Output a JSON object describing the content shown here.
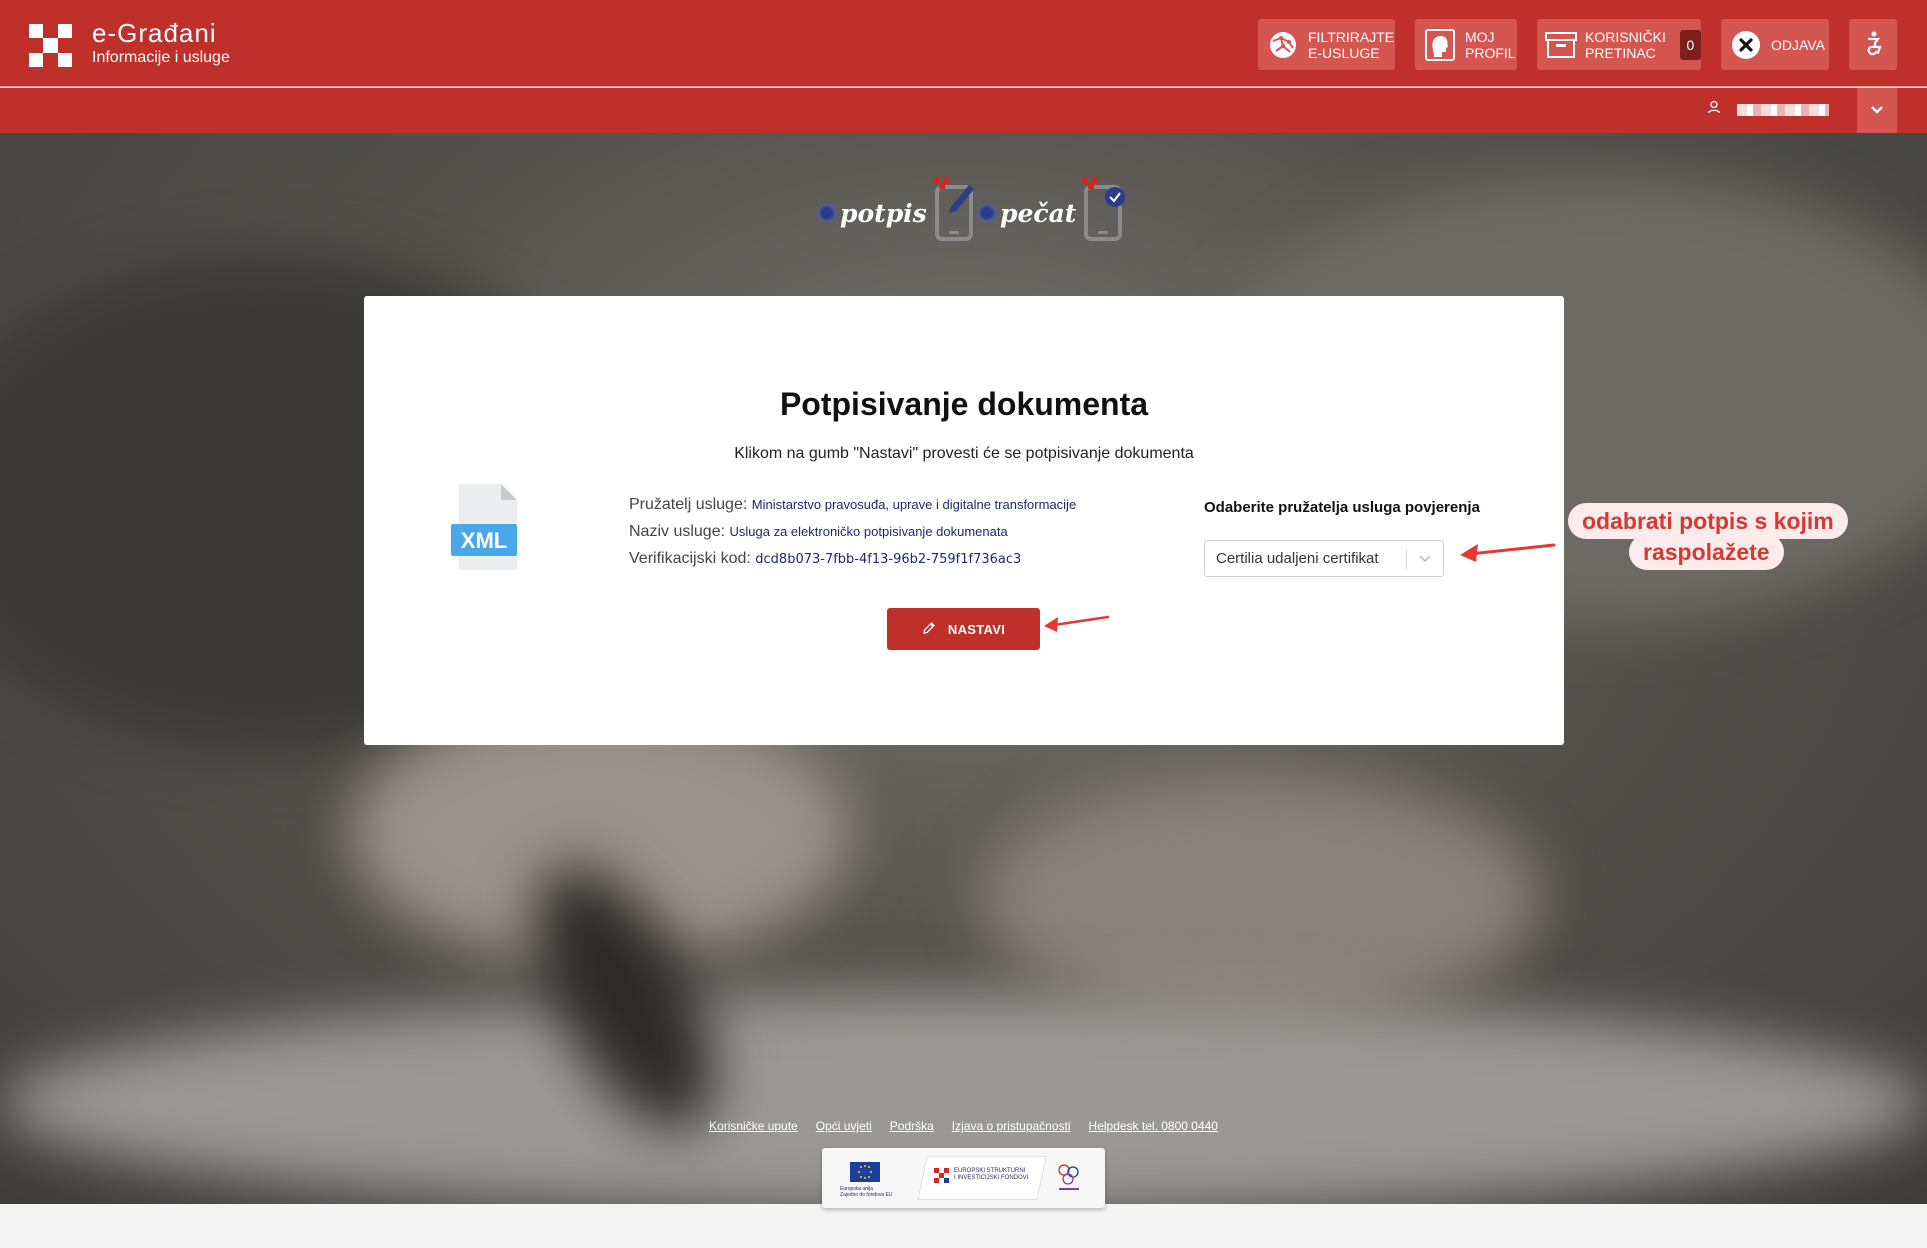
{
  "header": {
    "brand_title": "e-Građani",
    "brand_subtitle": "Informacije i usluge",
    "buttons": [
      {
        "id": "filter",
        "label": "FILTRIRAJTE\nE-USLUGE",
        "icon": "globe-network-icon"
      },
      {
        "id": "profile",
        "label": "MOJ\nPROFIL",
        "icon": "profile-head-icon"
      },
      {
        "id": "inbox",
        "label": "KORISNIČKI\nPRETINAC",
        "icon": "inbox-box-icon",
        "count": "0"
      },
      {
        "id": "logout",
        "label": "ODJAVA",
        "icon": "close-icon"
      },
      {
        "id": "accessibility",
        "label": "",
        "icon": "accessibility-icon"
      }
    ]
  },
  "service_logos": [
    {
      "word": "potpis",
      "icon": "phone-pen-icon"
    },
    {
      "word": "pečat",
      "icon": "phone-check-icon"
    }
  ],
  "card": {
    "title": "Potpisivanje dokumenta",
    "lead": "Klikom na gumb \"Nastavi\" provesti će se potpisivanje dokumenta",
    "file_type": "XML",
    "info": [
      {
        "label": "Pružatelj usluge:",
        "value": "Ministarstvo pravosuđa, uprave i digitalne transformacije"
      },
      {
        "label": "Naziv usluge:",
        "value": "Usluga za elektroničko potpisivanje dokumenata"
      },
      {
        "label": "Verifikacijski kod:",
        "value": "dcd8b073-7fbb-4f13-96b2-759f1f736ac3"
      }
    ],
    "select_label": "Odaberite pružatelja usluga povjerenja",
    "select_value": "Certilia udaljeni certifikat",
    "continue_label": "NASTAVI"
  },
  "annotations": {
    "line1": "odabrati potpis s kojim",
    "line2": "raspolažete",
    "color": "#d23a33"
  },
  "footer": {
    "links": [
      "Korisničke upute",
      "Opći uvjeti",
      "Podrška",
      "Izjava o pristupačnosti",
      "Helpdesk tel. 0800 0440"
    ],
    "eu_caption": "Europska unija\nZajedno do fondova EU",
    "esif_caption": "EUROPSKI STRUKTURNI\nI INVESTICIJSKI FONDOVI"
  },
  "colors": {
    "brand_red": "#c0302a",
    "button_red": "#d55550",
    "link_blue": "#1d2a6c"
  }
}
